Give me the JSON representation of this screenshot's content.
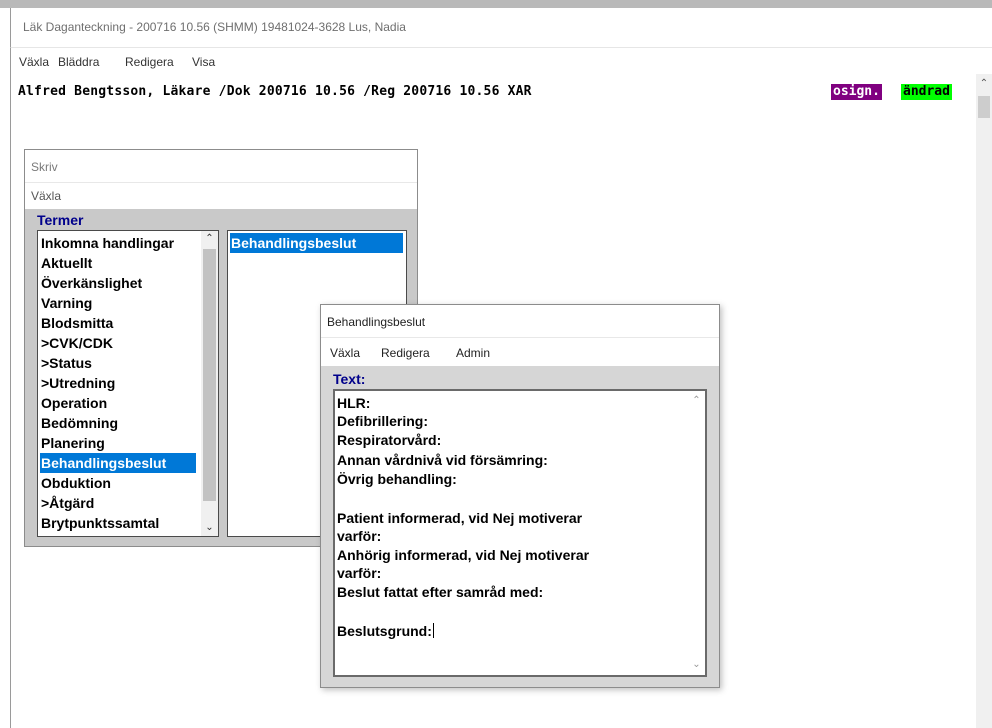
{
  "window": {
    "title": "Läk Daganteckning - 200716 10.56  (SHMM) 19481024-3628  Lus, Nadia",
    "menu": [
      "Växla",
      "Bläddra",
      "Redigera",
      "Visa"
    ]
  },
  "document": {
    "header": "Alfred Bengtsson, Läkare /Dok 200716 10.56 /Reg 200716 10.56 XAR",
    "badges": [
      {
        "label": "osign.",
        "bg": "#800080",
        "fg": "#ffffff"
      },
      {
        "label": "ändrad",
        "bg": "#00ff00",
        "fg": "#000000"
      }
    ]
  },
  "skriv": {
    "title": "Skriv",
    "menu": "Växla",
    "termer_label": "Termer",
    "terms": [
      "Inkomna handlingar",
      "Aktuellt",
      "Överkänslighet",
      "Varning",
      "Blodsmitta",
      ">CVK/CDK",
      ">Status",
      ">Utredning",
      "Operation",
      "Bedömning",
      "Planering",
      "Behandlingsbeslut",
      "Obduktion",
      ">Åtgärd",
      "Brytpunktssamtal"
    ],
    "selected_term": "Behandlingsbeslut",
    "subterms": [
      "Behandlingsbeslut"
    ]
  },
  "behandlingsbeslut": {
    "title": "Behandlingsbeslut",
    "menu": [
      "Växla",
      "Redigera",
      "Admin"
    ],
    "text_label": "Text:",
    "lines": [
      "HLR:",
      "Defibrillering:",
      "Respiratorvård:",
      "Annan vårdnivå vid försämring:",
      "Övrig behandling:",
      "",
      "Patient informerad, vid Nej motiverar",
      "varför:",
      "Anhörig informerad, vid Nej motiverar",
      "varför:",
      "Beslut fattat efter samråd med:",
      "",
      "Beslutsgrund:"
    ]
  },
  "icons": {
    "scroll_up": "chevron-up-icon",
    "scroll_down": "chevron-down-icon"
  }
}
